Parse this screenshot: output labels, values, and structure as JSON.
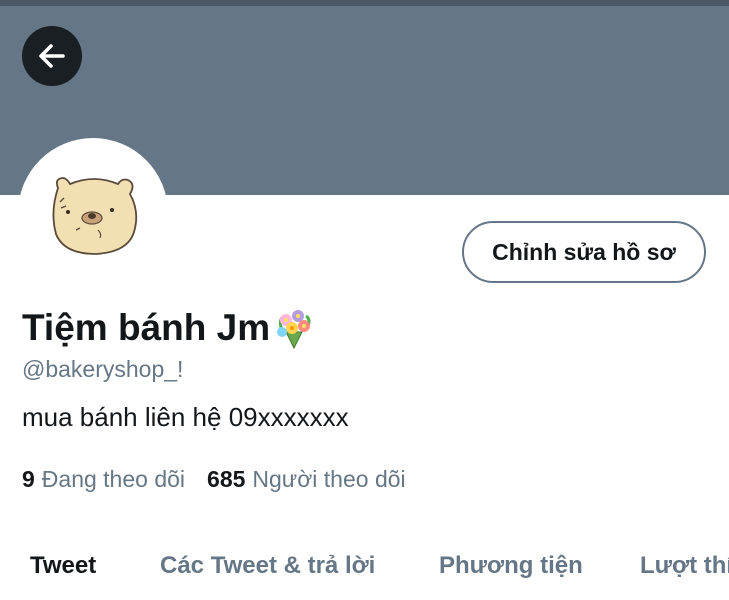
{
  "header": {
    "back_icon": "arrow-left-icon"
  },
  "colors": {
    "banner": "#657786",
    "text_primary": "#14171a",
    "text_secondary": "#657786"
  },
  "profile": {
    "edit_button_label": "Chỉnh sửa hồ sơ",
    "display_name": "Tiệm bánh Jm",
    "name_emoji_icon": "bouquet-icon",
    "handle": "@bakeryshop_!",
    "bio": "mua bánh liên hệ 09xxxxxxx",
    "following_count": "9",
    "following_label": "Đang theo dõi",
    "followers_count": "685",
    "followers_label": "Người theo dõi"
  },
  "tabs": [
    {
      "label": "Tweet",
      "active": true
    },
    {
      "label": "Các Tweet & trả lời",
      "active": false
    },
    {
      "label": "Phương tiện",
      "active": false
    },
    {
      "label": "Lượt thí",
      "active": false
    }
  ]
}
